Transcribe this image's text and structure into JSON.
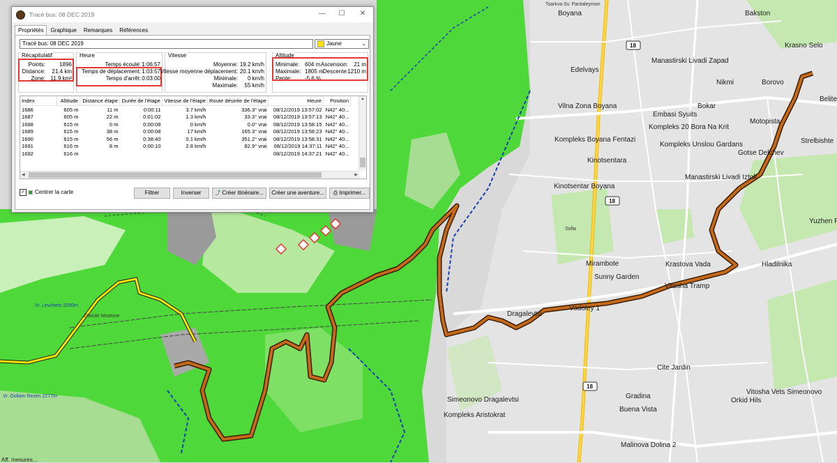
{
  "window": {
    "title": "Tracé bus: 08 DEC 2019",
    "minimize": "—",
    "maximize": "☐",
    "close": "✕"
  },
  "tabs": [
    {
      "label": "Propriétés",
      "active": true
    },
    {
      "label": "Graphique"
    },
    {
      "label": "Remarques"
    },
    {
      "label": "Références"
    }
  ],
  "track": {
    "name": "Tracé bus: 08 DEC 2019",
    "color_label": "Jaune",
    "color_hex": "#ffe600"
  },
  "summary": {
    "title": "Récapitulatif",
    "points_label": "Points:",
    "points_value": "1896",
    "distance_label": "Distance:",
    "distance_value": "21.4 km",
    "zone_label": "Zone:",
    "zone_value": "11.9 km²"
  },
  "time": {
    "title": "Heure",
    "elapsed_label": "Temps écoulé:",
    "elapsed_value": "1:06:57",
    "moving_label": "Temps de déplacement:",
    "moving_value": "1:03:57",
    "stopped_label": "Temps d'arrêt:",
    "stopped_value": "0:03:00"
  },
  "speed": {
    "title": "Vitesse",
    "avg_label": "Moyenne:",
    "avg_value": "19.2 km/h",
    "avg_moving_label": "Vitesse moyenne déplacement:",
    "avg_moving_value": "20.1 km/h",
    "min_label": "Minimale:",
    "min_value": "0 km/h",
    "max_label": "Maximale:",
    "max_value": "55 km/h"
  },
  "altitude": {
    "title": "Altitude",
    "min_label": "Minimale:",
    "min_value": "604 m",
    "max_label": "Maximale:",
    "max_value": "1805 m",
    "slope_label": "Pente:",
    "slope_value": "-5.6 %",
    "ascent_label": "Ascension:",
    "ascent_value": "21 m",
    "descent_label": "Descente:",
    "descent_value": "1210 m"
  },
  "table": {
    "headers": [
      "Index",
      "Altitude",
      "Distance étape",
      "Durée de l'étape",
      "Vitesse de l'étape",
      "Route désirée de l'étape",
      "Heure",
      "Position"
    ],
    "rows": [
      [
        "1686",
        "605 m",
        "11 m",
        "0:00:11",
        "3.7 km/h",
        "336.3° vrai",
        "08/12/2019 13:57:02",
        "N42° 40..."
      ],
      [
        "1687",
        "605 m",
        "22 m",
        "0:01:02",
        "1.3 km/h",
        "33.3° vrai",
        "08/12/2019 13:57:13",
        "N42° 40..."
      ],
      [
        "1688",
        "615 m",
        "0 m",
        "0:00:08",
        "0 km/h",
        "0.0° vrai",
        "08/12/2019 13:58:15",
        "N42° 40..."
      ],
      [
        "1689",
        "615 m",
        "38 m",
        "0:00:08",
        "17 km/h",
        "165.3° vrai",
        "08/12/2019 13:58:23",
        "N42° 40..."
      ],
      [
        "1690",
        "615 m",
        "56 m",
        "0:38:40",
        "0.1 km/h",
        "351.2° vrai",
        "08/12/2019 13:58:31",
        "N42° 40..."
      ],
      [
        "1691",
        "616 m",
        "8 m",
        "0:00:10",
        "2.8 km/h",
        "82.9° vrai",
        "08/12/2019 14:37:11",
        "N42° 40..."
      ],
      [
        "1692",
        "616 m",
        "",
        "",
        "",
        "",
        "08/12/2019 14:37:21",
        "N42° 40..."
      ]
    ]
  },
  "actions": {
    "center_map_label": "Centrer la carte",
    "filter": "Filtrer",
    "invert": "Inverser",
    "create_route": "Créer itinéraire...",
    "create_adventure": "Créer une aventure...",
    "print": "Imprimer..."
  },
  "map": {
    "status": "Aff. mesures...",
    "labels": {
      "tsarkva": "Tsarkva Sv. Pantaleymon",
      "boyana": "Boyana",
      "bakston": "Bakston",
      "krasno_selo": "Krasno Selo",
      "manastirski_zapad": "Manastirski Livadi Zapad",
      "edelvays": "Edelvays",
      "nikmi": "Nikmi",
      "borovo": "Borovo",
      "vilna_zona": "Vilna Zona Boyana",
      "bokar": "Bokar",
      "embasi": "Embasi Syuits",
      "kompleks_20": "Kompleks 20 Bora Na Krit",
      "motopista": "Motopista",
      "beliche": "Belite",
      "strelbishte": "Strelbishte",
      "fentazi": "Kompleks Boyana Fentazi",
      "unslou": "Kompleks Unslou Gardans",
      "gotse": "Gotse Delchev",
      "kinotsentara": "Kinotsentara",
      "livadi_iztok": "Manastirski Livadi Iztok",
      "kinotsentar_boyana": "Kinotsentar Boyana",
      "yuzhen": "Yuzhen P",
      "sofia": "Sofia",
      "mirambote": "Mirambote",
      "krastova_vada": "Krastova Vada",
      "hladilnika": "Hladilnika",
      "sunny_garden": "Sunny Garden",
      "vitosha_tramp": "Vitosha Tramp",
      "dragalevtsi": "Dragalevtsi",
      "vodoley": "Vodoley 1",
      "cite_jardin": "Cite Jardin",
      "simeonovo_dragalevtsi": "Simeonovo Dragalevtsi",
      "gradina": "Gradina",
      "buena_vista": "Buena Vista",
      "vitosha_vets": "Vitosha Vets Simeonovo",
      "orkid": "Orkid Hils",
      "kompleks_aristokrat": "Kompleks Aristokrat",
      "malinova": "Malinova Dolina 2",
      "vr_levcheto": "Vr. Levcheto 2050m",
      "vr_goliam": "Vr. Goliam Rezen 2277m",
      "zlatnite": "Zlatnite Mostove"
    },
    "shields": [
      "18",
      "18",
      "18"
    ]
  }
}
